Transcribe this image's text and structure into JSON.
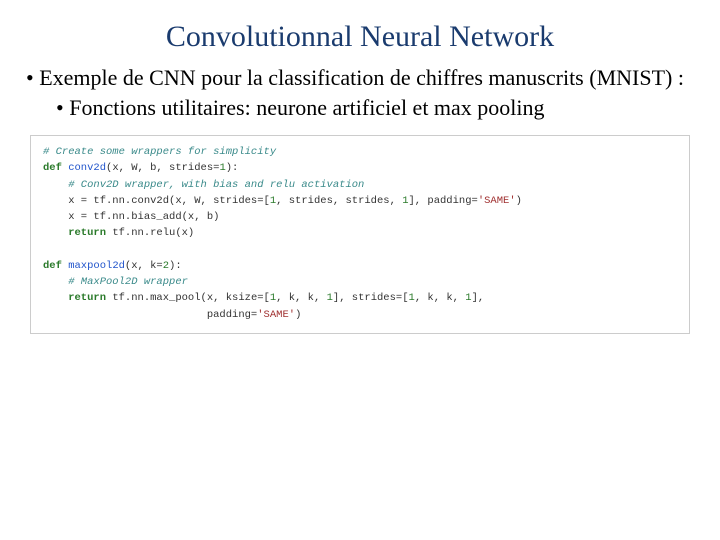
{
  "title": "Convolutionnal Neural Network",
  "bullet1": "• Exemple de CNN pour la classification de chiffres manuscrits (MNIST) :",
  "bullet2": "• Fonctions utilitaires: neurone artificiel et max pooling",
  "code": {
    "l1": "# Create some wrappers for simplicity",
    "l2a": "def",
    "l2b": " conv2d",
    "l2c": "(x, W, b, strides=",
    "l2d": "1",
    "l2e": "):",
    "l3": "    # Conv2D wrapper, with bias and relu activation",
    "l4a": "    x = tf.nn.conv2d(x, W, strides=[",
    "l4b": "1",
    "l4c": ", strides, strides, ",
    "l4d": "1",
    "l4e": "], padding=",
    "l4f": "'SAME'",
    "l4g": ")",
    "l5": "    x = tf.nn.bias_add(x, b)",
    "l6a": "    return",
    "l6b": " tf.nn.relu(x)",
    "l7a": "def",
    "l7b": " maxpool2d",
    "l7c": "(x, k=",
    "l7d": "2",
    "l7e": "):",
    "l8": "    # MaxPool2D wrapper",
    "l9a": "    return",
    "l9b": " tf.nn.max_pool(x, ksize=[",
    "l9c": "1",
    "l9d": ", k, k, ",
    "l9e": "1",
    "l9f": "], strides=[",
    "l9g": "1",
    "l9h": ", k, k, ",
    "l9i": "1",
    "l9j": "],",
    "l10a": "                          padding=",
    "l10b": "'SAME'",
    "l10c": ")"
  }
}
